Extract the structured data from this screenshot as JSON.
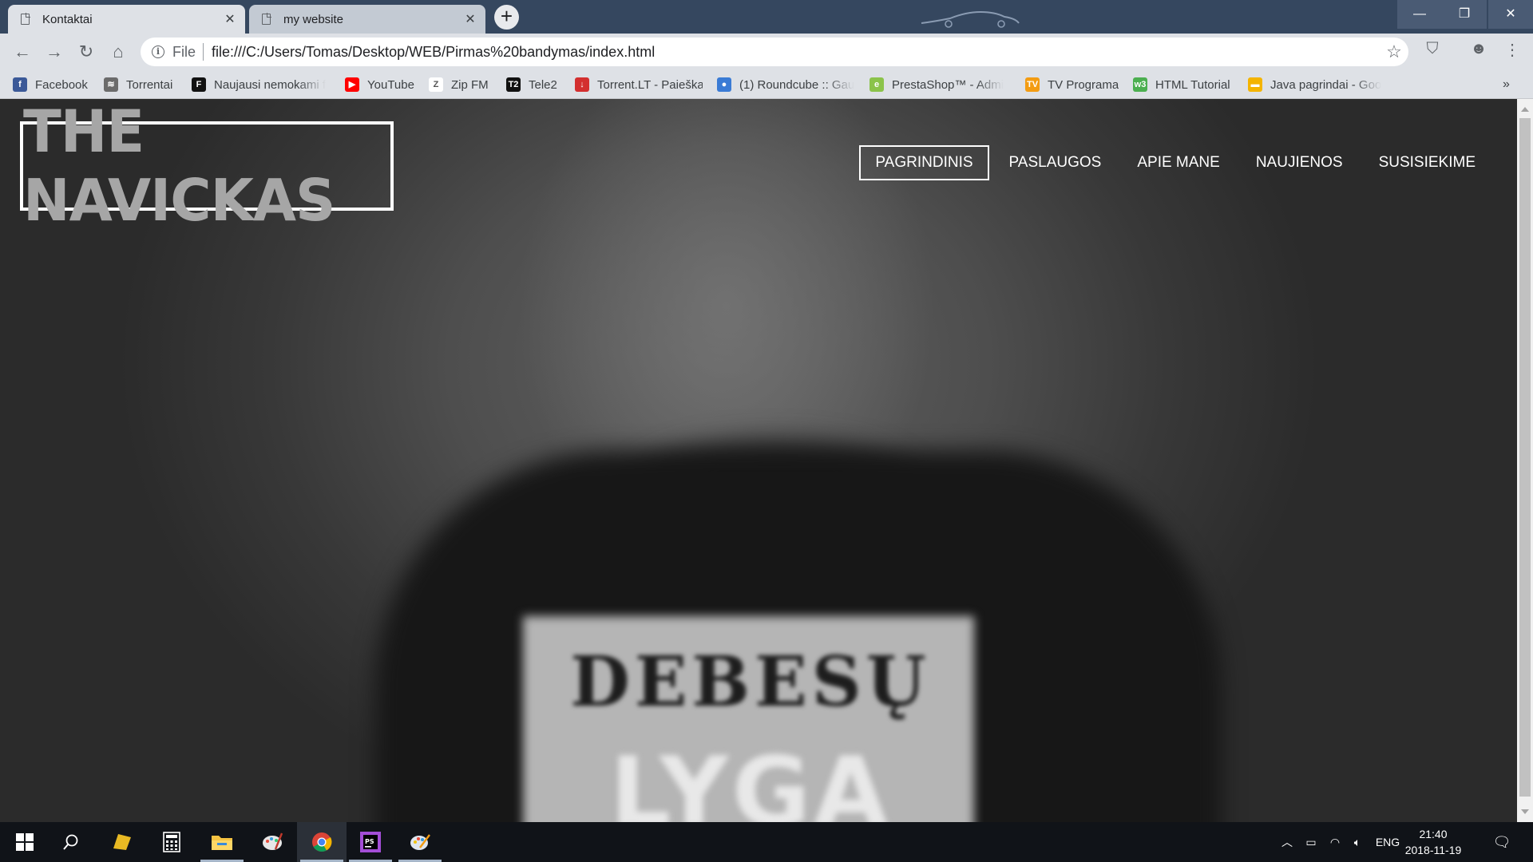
{
  "browser": {
    "tabs": [
      {
        "title": "Kontaktai",
        "active": true
      },
      {
        "title": "my website",
        "active": false
      }
    ],
    "new_tab_symbol": "+",
    "window_controls": {
      "minimize": "—",
      "restore": "❐",
      "close": "✕"
    },
    "address": {
      "scheme_label": "File",
      "url": "file:///C:/Users/Tomas/Desktop/WEB/Pirmas%20bandymas/index.html"
    },
    "bookmarks": [
      {
        "label": "Facebook",
        "icon": "facebook-icon",
        "color": "#3b5998",
        "glyph": "f"
      },
      {
        "label": "Torrentai",
        "icon": "torrentai-icon",
        "color": "#6b6b6b",
        "glyph": "≋"
      },
      {
        "label": "Naujausi nemokami f",
        "icon": "f-letter-icon",
        "color": "#111111",
        "glyph": "F"
      },
      {
        "label": "YouTube",
        "icon": "youtube-icon",
        "color": "#ff0000",
        "glyph": "▶"
      },
      {
        "label": "Zip FM",
        "icon": "zipfm-icon",
        "color": "#ffffff",
        "glyph": "Z"
      },
      {
        "label": "Tele2",
        "icon": "tele2-icon",
        "color": "#111111",
        "glyph": "T2"
      },
      {
        "label": "Torrent.LT - Paieška",
        "icon": "torrentlt-icon",
        "color": "#d32f2f",
        "glyph": "↓"
      },
      {
        "label": "(1) Roundcube :: Gau",
        "icon": "roundcube-icon",
        "color": "#3a7bd5",
        "glyph": "●"
      },
      {
        "label": "PrestaShop™ - Admi",
        "icon": "prestashop-icon",
        "color": "#8bc34a",
        "glyph": "e"
      },
      {
        "label": "TV Programa",
        "icon": "tv-icon",
        "color": "#f39c12",
        "glyph": "TV"
      },
      {
        "label": "HTML Tutorial",
        "icon": "w3schools-icon",
        "color": "#4caf50",
        "glyph": "w3"
      },
      {
        "label": "Java pagrindai - Goo",
        "icon": "google-slides-icon",
        "color": "#f4b400",
        "glyph": "▬"
      }
    ],
    "bookmarks_more": "»"
  },
  "page": {
    "logo_text": "THE NAVICKAS",
    "nav": [
      "PAGRINDINIS",
      "PASLAUGOS",
      "APIE MANE",
      "NAUJIENOS",
      "SUSISIEKIME"
    ],
    "active_nav_index": 0,
    "hero_shirt_text": [
      "DEBESŲ",
      "LYGA"
    ]
  },
  "taskbar": {
    "language": "ENG",
    "time": "21:40",
    "date": "2018-11-19"
  },
  "colors": {
    "titlebar": "#35475f",
    "toolbar": "#dee1e6",
    "taskbar": "#101318",
    "logo_text": "#a6a6a6"
  }
}
